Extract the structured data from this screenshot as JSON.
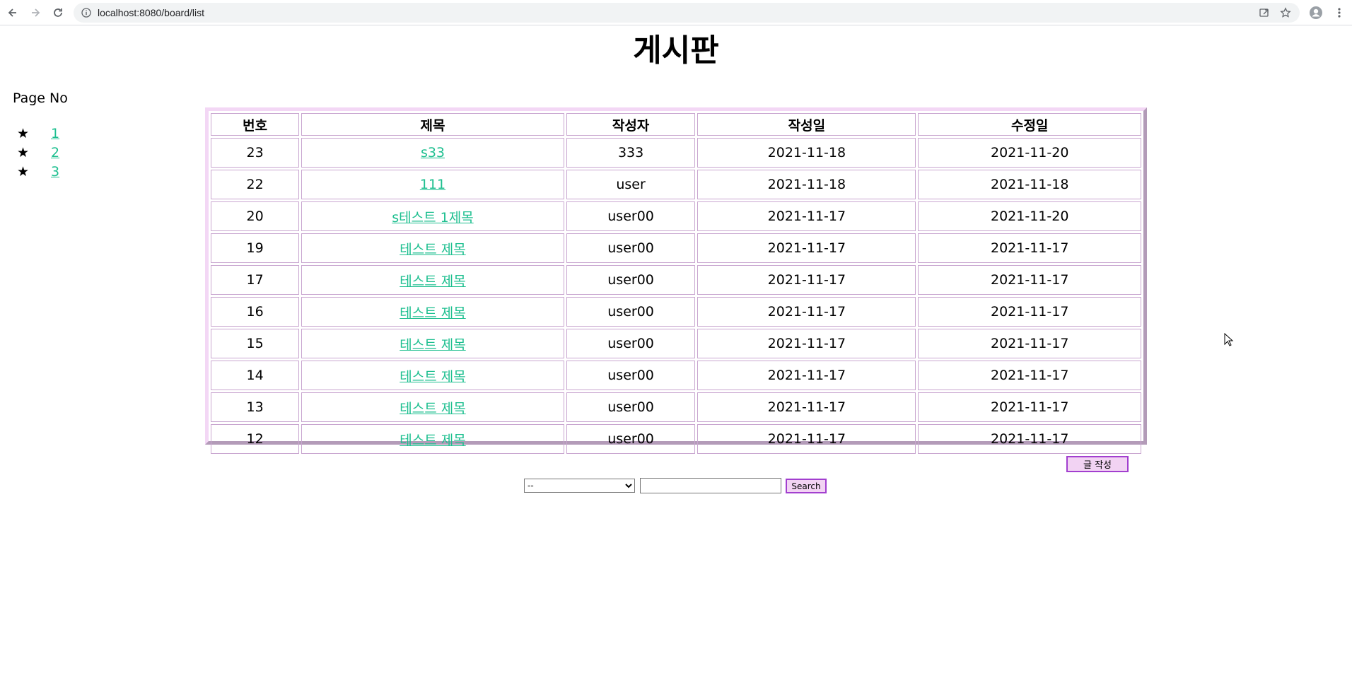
{
  "browser": {
    "url": "localhost:8080/board/list"
  },
  "page": {
    "title": "게시판"
  },
  "pagination": {
    "label": "Page No",
    "marker": "★",
    "pages": [
      "1",
      "2",
      "3"
    ]
  },
  "board": {
    "columns": [
      "번호",
      "제목",
      "작성자",
      "작성일",
      "수정일"
    ],
    "rows": [
      {
        "no": "23",
        "title": "s33",
        "writer": "333",
        "created": "2021-11-18",
        "updated": "2021-11-20"
      },
      {
        "no": "22",
        "title": "111",
        "writer": "user",
        "created": "2021-11-18",
        "updated": "2021-11-18"
      },
      {
        "no": "20",
        "title": "s테스트 1제목",
        "writer": "user00",
        "created": "2021-11-17",
        "updated": "2021-11-20"
      },
      {
        "no": "19",
        "title": "테스트 제목",
        "writer": "user00",
        "created": "2021-11-17",
        "updated": "2021-11-17"
      },
      {
        "no": "17",
        "title": "테스트 제목",
        "writer": "user00",
        "created": "2021-11-17",
        "updated": "2021-11-17"
      },
      {
        "no": "16",
        "title": "테스트 제목",
        "writer": "user00",
        "created": "2021-11-17",
        "updated": "2021-11-17"
      },
      {
        "no": "15",
        "title": "테스트 제목",
        "writer": "user00",
        "created": "2021-11-17",
        "updated": "2021-11-17"
      },
      {
        "no": "14",
        "title": "테스트 제목",
        "writer": "user00",
        "created": "2021-11-17",
        "updated": "2021-11-17"
      },
      {
        "no": "13",
        "title": "테스트 제목",
        "writer": "user00",
        "created": "2021-11-17",
        "updated": "2021-11-17"
      },
      {
        "no": "12",
        "title": "테스트 제목",
        "writer": "user00",
        "created": "2021-11-17",
        "updated": "2021-11-17"
      }
    ]
  },
  "actions": {
    "write_label": "글 작성"
  },
  "search": {
    "selected_type": "--",
    "keyword": "",
    "button_label": "Search"
  },
  "colors": {
    "link": "#1dbf8f",
    "button_bg": "#f2d3f3",
    "button_border": "#a23fcf",
    "table_border": "#c9a6d0"
  }
}
